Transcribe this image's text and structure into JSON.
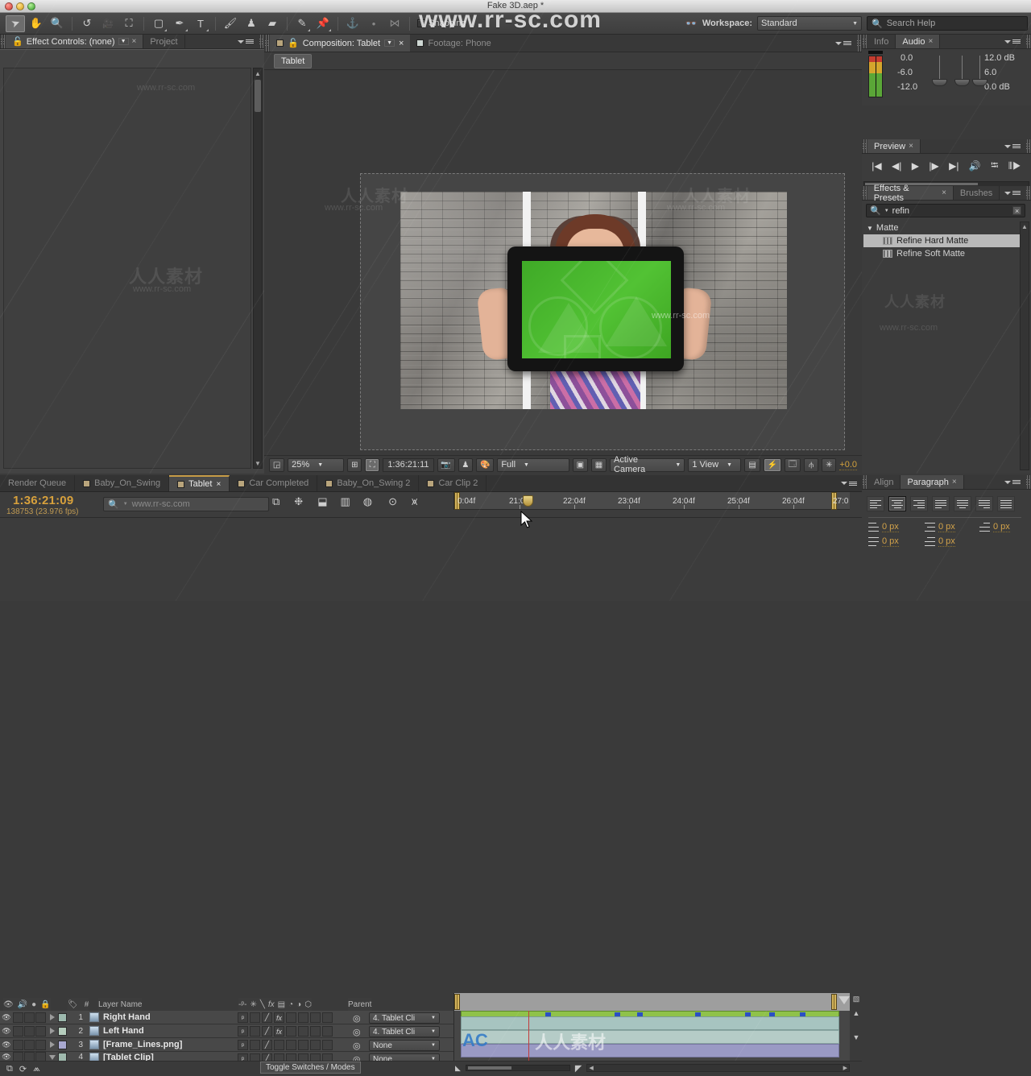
{
  "window": {
    "title": "Fake 3D.aep *"
  },
  "toolbar": {
    "tools": [
      {
        "name": "selection-tool",
        "glyph": "➤"
      },
      {
        "name": "hand-tool",
        "glyph": "✋"
      },
      {
        "name": "zoom-tool",
        "glyph": "🔍"
      },
      {
        "name": "rotation-tool",
        "glyph": "↺"
      },
      {
        "name": "camera-tool",
        "glyph": "🎥"
      },
      {
        "name": "pan-behind-tool",
        "glyph": "✣"
      },
      {
        "name": "shape-tool",
        "glyph": "▢"
      },
      {
        "name": "pen-tool",
        "glyph": "✒"
      },
      {
        "name": "type-tool",
        "glyph": "T"
      },
      {
        "name": "brush-tool",
        "glyph": "🖌"
      },
      {
        "name": "clone-stamp-tool",
        "glyph": "♟"
      },
      {
        "name": "eraser-tool",
        "glyph": "▰"
      },
      {
        "name": "roto-brush-tool",
        "glyph": "✎"
      },
      {
        "name": "puppet-pin-tool",
        "glyph": "📌"
      }
    ],
    "align_icons": [
      "⚓",
      "•",
      "⋈"
    ],
    "snapping_label": "Snapping",
    "workspace_label": "Workspace:",
    "workspace_value": "Standard",
    "search_help_placeholder": "Search Help"
  },
  "effect_controls": {
    "tabs": [
      {
        "label": "Effect Controls: (none)",
        "active": true,
        "closable": true,
        "has_menu": true
      },
      {
        "label": "Project",
        "active": false,
        "closable": false
      }
    ]
  },
  "composition": {
    "tabs": [
      {
        "label": "Composition: Tablet",
        "active": true,
        "closable": true
      },
      {
        "label": "Footage: Phone",
        "active": false,
        "closable": false
      }
    ],
    "breadcrumb": "Tablet",
    "bottom_bar": {
      "zoom": "25%",
      "time": "1:36:21:11",
      "resolution": "Full",
      "camera": "Active Camera",
      "views": "1 View",
      "exposure": "+0.0"
    }
  },
  "audio": {
    "tabs": [
      {
        "label": "Info",
        "active": false
      },
      {
        "label": "Audio",
        "active": true,
        "closable": true
      }
    ],
    "left_labels": [
      "0.0",
      "-6.0",
      "-12.0"
    ],
    "right_labels": [
      "12.0 dB",
      "6.0",
      "0.0 dB"
    ]
  },
  "preview": {
    "tabs": [
      {
        "label": "Preview",
        "active": true,
        "closable": true
      }
    ],
    "buttons": [
      {
        "name": "first-frame-button",
        "glyph": "|◀"
      },
      {
        "name": "previous-frame-button",
        "glyph": "◀|"
      },
      {
        "name": "play-button",
        "glyph": "▶"
      },
      {
        "name": "next-frame-button",
        "glyph": "|▶"
      },
      {
        "name": "last-frame-button",
        "glyph": "▶|"
      },
      {
        "name": "audio-button",
        "glyph": "🔊"
      },
      {
        "name": "loop-button",
        "glyph": "⭾"
      },
      {
        "name": "ram-preview-button",
        "glyph": "⦀▶"
      }
    ]
  },
  "effects_presets": {
    "tabs": [
      {
        "label": "Effects & Presets",
        "active": true,
        "closable": true
      },
      {
        "label": "Brushes",
        "active": false,
        "closable": false
      }
    ],
    "search_value": "refin",
    "group": "Matte",
    "items": [
      {
        "label": "Refine Hard Matte",
        "selected": true
      },
      {
        "label": "Refine Soft Matte",
        "selected": false
      }
    ]
  },
  "timeline": {
    "tabs": [
      {
        "label": "Render Queue",
        "active": false,
        "swatch": false
      },
      {
        "label": "Baby_On_Swing",
        "active": false,
        "swatch": true
      },
      {
        "label": "Tablet",
        "active": true,
        "swatch": true,
        "closable": true
      },
      {
        "label": "Car Completed",
        "active": false,
        "swatch": true
      },
      {
        "label": "Baby_On_Swing 2",
        "active": false,
        "swatch": true
      },
      {
        "label": "Car Clip 2",
        "active": false,
        "swatch": true
      }
    ],
    "current_time": "1:36:21:09",
    "frame_info": "138753 (23.976 fps)",
    "search_placeholder": "www.rr-sc.com",
    "header_icons": [
      {
        "name": "composition-mini-flowchart-icon",
        "glyph": "⧉"
      },
      {
        "name": "draft-3d-icon",
        "glyph": "❉"
      },
      {
        "name": "hide-shy-layers-icon",
        "glyph": "⬓"
      },
      {
        "name": "frame-blending-icon",
        "glyph": "▥"
      },
      {
        "name": "motion-blur-icon",
        "glyph": "◍"
      },
      {
        "name": "brainstorm-icon",
        "glyph": "⊙"
      },
      {
        "name": "graph-editor-icon",
        "glyph": "⩙"
      }
    ],
    "columns": [
      "Layer Name",
      "Parent"
    ],
    "ruler_labels": [
      "0:04f",
      "21:04f",
      "22:04f",
      "23:04f",
      "24:04f",
      "25:04f",
      "26:04f",
      "27:0"
    ],
    "layers": [
      {
        "num": "1",
        "name": "Right Hand",
        "color": "#9db9ae",
        "parent": "4. Tablet Cli",
        "fx": true,
        "three_d": false,
        "bar_color": "#a7c4c0"
      },
      {
        "num": "2",
        "name": "Left Hand",
        "color": "#b5cdbd",
        "parent": "4. Tablet Cli",
        "fx": true,
        "three_d": false,
        "bar_color": "#a7c4c0"
      },
      {
        "num": "3",
        "name": "[Frame_Lines.png]",
        "color": "#a8a8d0",
        "parent": "None",
        "fx": false,
        "three_d": false,
        "bar_color": "#9a9ac4"
      },
      {
        "num": "4",
        "name": "[Tablet Clip]",
        "color": "#9fb9ad",
        "parent": "None",
        "fx": false,
        "three_d": false,
        "bar_color": "#a7c4c0"
      }
    ],
    "footer_label": "Toggle Switches / Modes"
  },
  "paragraph": {
    "tabs": [
      {
        "label": "Align",
        "active": false
      },
      {
        "label": "Paragraph",
        "active": true,
        "closable": true
      }
    ],
    "indents": [
      {
        "name": "indent-left-margin",
        "value": "0 px"
      },
      {
        "name": "indent-right-margin",
        "value": "0 px"
      },
      {
        "name": "indent-first-line",
        "value": "0 px"
      },
      {
        "name": "space-before-paragraph",
        "value": "0 px"
      },
      {
        "name": "space-after-paragraph",
        "value": "0 px"
      }
    ]
  },
  "watermarks": {
    "top": "www.rr-sc.com",
    "center": "人人素材",
    "logo": "AC"
  },
  "colors": {
    "accent_gold": "#d8a13c",
    "panel_bg": "#3c3c3c",
    "green_screen": "#4cb62e"
  }
}
